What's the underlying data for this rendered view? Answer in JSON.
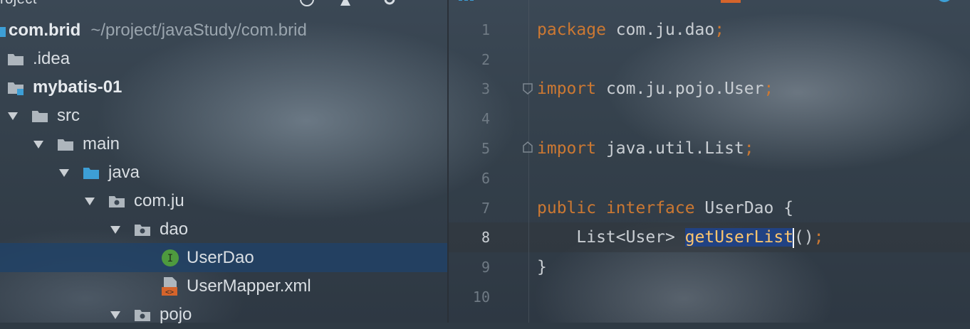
{
  "project_panel": {
    "title": "roject",
    "tree": [
      {
        "label": "com.brid",
        "path": "~/project/javaStudy/com.brid",
        "type": "module-root"
      },
      {
        "label": ".idea",
        "type": "folder"
      },
      {
        "label": "mybatis-01",
        "type": "module"
      },
      {
        "label": "src",
        "type": "folder",
        "expanded": true
      },
      {
        "label": "main",
        "type": "folder",
        "expanded": true
      },
      {
        "label": "java",
        "type": "source-folder",
        "expanded": true
      },
      {
        "label": "com.ju",
        "type": "package",
        "expanded": true
      },
      {
        "label": "dao",
        "type": "package",
        "expanded": true
      },
      {
        "label": "UserDao",
        "type": "interface",
        "selected": true
      },
      {
        "label": "UserMapper.xml",
        "type": "xml"
      },
      {
        "label": "pojo",
        "type": "package",
        "expanded": true
      }
    ]
  },
  "editor": {
    "line_numbers": [
      "1",
      "2",
      "3",
      "4",
      "5",
      "6",
      "7",
      "8",
      "9",
      "10"
    ],
    "current_line": "8",
    "lines": {
      "l1_kw": "package",
      "l1_rest": " com.ju.dao",
      "l1_semi": ";",
      "l3_kw": "import",
      "l3_rest": " com.ju.pojo.User",
      "l3_semi": ";",
      "l5_kw": "import",
      "l5_rest": " java.util.List",
      "l5_semi": ";",
      "l7_kw1": "public",
      "l7_kw2": "interface",
      "l7_rest": " UserDao {",
      "l8_indent": "    List<User> ",
      "l8_selected": "getUserList",
      "l8_paren": "()",
      "l8_semi": ";",
      "l9": "}"
    }
  },
  "colors": {
    "keyword": "#cc7832",
    "selection": "#214283",
    "selected_row": "#214266",
    "interface_icon": "#4e9a3e",
    "xml_icon": "#d5642b",
    "source_folder": "#3d9fd6"
  }
}
